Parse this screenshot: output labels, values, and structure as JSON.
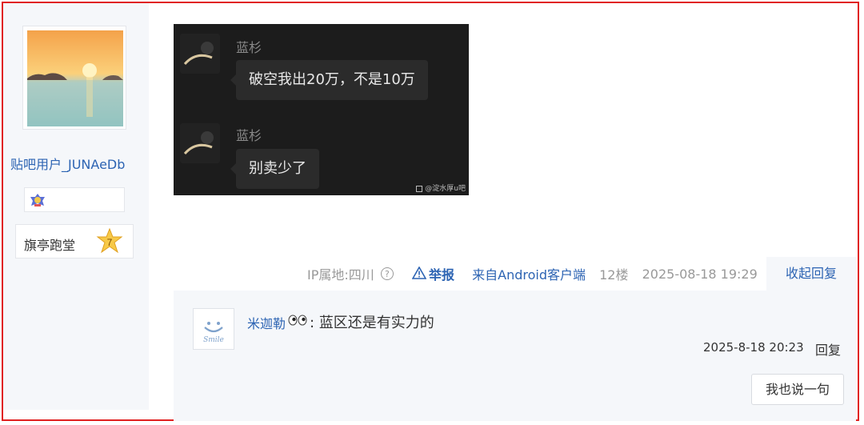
{
  "author": {
    "username": "贴吧用户_JUNAeDb",
    "level_name": "旗亭跑堂",
    "level_number": "7"
  },
  "post_image": {
    "messages": [
      {
        "name": "蓝杉",
        "text": "破空我出20万，不是10万"
      },
      {
        "name": "蓝杉",
        "text": "别卖少了"
      }
    ],
    "watermark": "@淀水厚u吧"
  },
  "meta": {
    "ip": "IP属地:四川",
    "help_icon": "?",
    "report": "举报",
    "client": "来自Android客户端",
    "floor": "12楼",
    "time": "2025-08-18 19:29",
    "collapse": "收起回复"
  },
  "reply": {
    "user": "米迦勒",
    "separator": ":",
    "text": "蓝区还是有实力的",
    "time": "2025-8-18 20:23",
    "reply_label": "回复",
    "say_button": "我也说一句",
    "avatar_text": "Smile"
  },
  "colors": {
    "link": "#2d64b3",
    "frame": "#e02020",
    "panel": "#f5f7fa"
  }
}
